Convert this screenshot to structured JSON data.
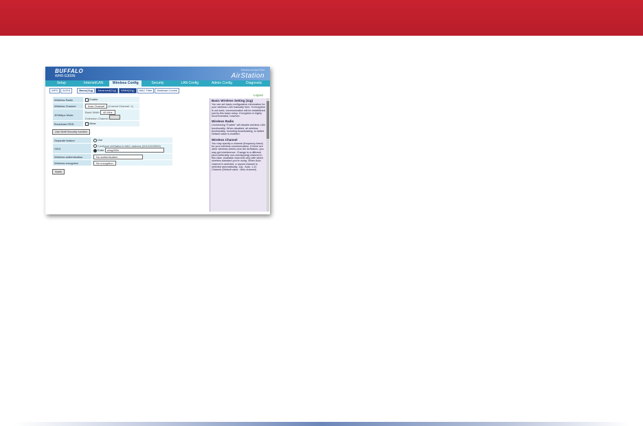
{
  "brand": "BUFFALO",
  "model": "WHR-G300N",
  "product_line": "Wireless Access Point",
  "product_name": "AirStation",
  "tabs": [
    "Setup",
    "Internet/LAN",
    "Wireless Config",
    "Security",
    "LAN Config",
    "Admin Config",
    "Diagnostic"
  ],
  "subtabs": [
    "WPS",
    "AOSS",
    "Basic(11g)",
    "Advanced(11g)",
    "WMM(11g)",
    "MAC Filter",
    "Multicast Control"
  ],
  "logout": "Logout",
  "form1": {
    "wireless_radio_label": "Wireless Radio",
    "wireless_radio_value": "Enable",
    "channel_label": "Wireless Channel",
    "channel_value": "Auto Channel",
    "channel_current": "(Current Channel: 1)",
    "mode_label": "300Mbps Mode",
    "band_width_label": "Band Width",
    "band_width_value": "40 MHz",
    "ext_channel_label": "Extension Channel",
    "broadcast_label": "Broadcast SSID",
    "broadcast_value": "Allow"
  },
  "multi_button": "Use Multi Security function",
  "form2": {
    "separate_label": "Separate feature",
    "separate_value": "Use",
    "ssid_label": "SSID",
    "ssid_opt1": "Configure AirStation's MAC address (00124325999)",
    "ssid_opt2": "Enter",
    "ssid_value": "whrg300n",
    "auth_label": "Wireless authentication",
    "auth_value": "No authentication",
    "enc_label": "Wireless encryption",
    "enc_value": "No encryption"
  },
  "apply": "Apply",
  "help": [
    {
      "h": "Basic Wireless Setting (11g)",
      "p": "You can set basic configuration information for your wireless LAN manually here. If encryption is not used, communication will be established just by this basic setup. Encryption is highly recommended, however."
    },
    {
      "h": "Wireless Radio",
      "p": "Unchecking \"Enable\" will disable wireless LAN functionality. When disabled, all wireless functionality, including broadcasting, is halted. Default value is enabled."
    },
    {
      "h": "Wireless Channel",
      "p": "You may specify a channel (frequency band) for your wireless communication. If there are other wireless clients near the AirStation, you may get interference. Change to a different (and preferably non-overlapping) channel in this case. Available channels vary with which wireless standard you're using. When Auto channel is selected, a vacant channel is selected automatically. 11g : Auto, 1-11 Channel (Default value : Auto channel)"
    }
  ],
  "colors": {
    "top_bar": "#c8222f",
    "header": "#2a5ea6",
    "nav": "#2fa9c2",
    "help_bg": "#e9e3f2"
  }
}
